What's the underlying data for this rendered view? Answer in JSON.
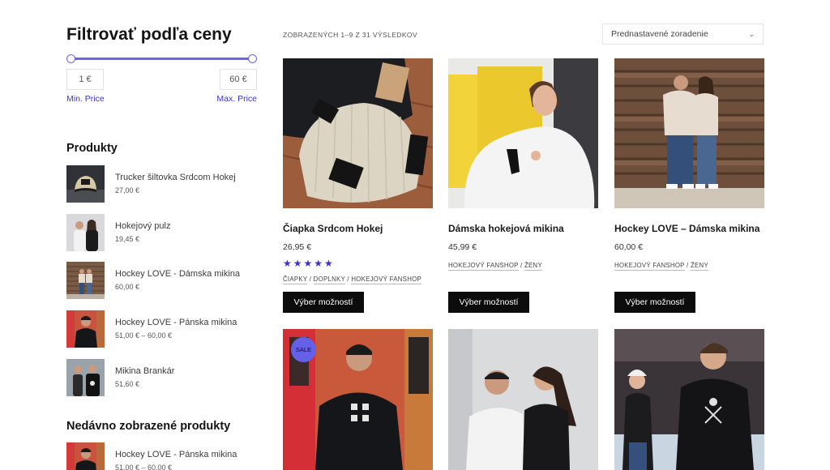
{
  "filter": {
    "title": "Filtrovať podľa ceny",
    "min_value": "1 €",
    "max_value": "60 €",
    "min_label": "Min. Price",
    "max_label": "Max. Price",
    "accent_color": "#6d63e6"
  },
  "products_widget": {
    "title": "Produkty",
    "items": [
      {
        "name": "Trucker šiltovka Srdcom Hokej",
        "price": "27,00 €"
      },
      {
        "name": "Hokejový pulz",
        "price": "19,45 €"
      },
      {
        "name": "Hockey LOVE - Dámska mikina",
        "price": "60,00 €"
      },
      {
        "name": "Hockey LOVE - Pánska mikina",
        "price": "51,00 € – 60,00 €"
      },
      {
        "name": "Mikina Brankár",
        "price": "51,60 €"
      }
    ]
  },
  "recent_widget": {
    "title": "Nedávno zobrazené produkty",
    "items": [
      {
        "name": "Hockey LOVE - Pánska mikina",
        "price": "51,00 € – 60,00 €"
      }
    ]
  },
  "toolbar": {
    "result_count": "ZOBRAZENÝCH 1–9 Z 31 VÝSLEDKOV",
    "sort_selected": "Prednastavené zoradenie"
  },
  "products": [
    {
      "title": "Čiapka Srdcom Hokej",
      "price": "26,95 €",
      "rating": 5,
      "stars": "★★★★★",
      "categories": [
        "ČIAPKY",
        "DOPLNKY",
        "HOKEJOVÝ FANSHOP"
      ],
      "button": "Výber možností"
    },
    {
      "title": "Dámska hokejová mikina",
      "price": "45,99 €",
      "categories": [
        "HOKEJOVÝ FANSHOP",
        "ŽENY"
      ],
      "button": "Výber možností"
    },
    {
      "title": "Hockey LOVE – Dámska mikina",
      "price": "60,00 €",
      "categories": [
        "HOKEJOVÝ FANSHOP",
        "ŽENY"
      ],
      "button": "Výber možností"
    },
    {
      "badge": "SALE"
    }
  ]
}
